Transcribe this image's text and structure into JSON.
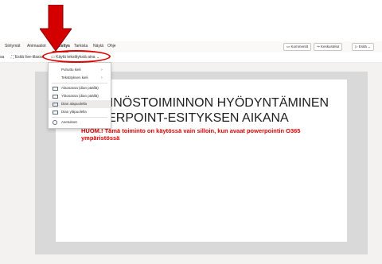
{
  "ribbon": {
    "tabs": [
      "Siirtymät",
      "Animaatiot",
      "Diaesitys",
      "Tarkista",
      "Näytä",
      "Ohje"
    ],
    "active_tab": "Diaesitys",
    "right_buttons": [
      "Kommentit",
      "Keskustelut",
      "Esitä"
    ]
  },
  "commands": {
    "left_cut": "sa",
    "present_live": "Esitä live-tilassa",
    "subtitles_button": "Käytä tekstityksiä aina"
  },
  "menu": {
    "items": [
      {
        "label": "Puhuttu kieli",
        "icon": "none",
        "submenu": true
      },
      {
        "label": "Tekstityksen kieli",
        "icon": "none",
        "submenu": true
      },
      {
        "label": "Alaosassa (dian päällä)",
        "icon": "bottom-overlay-icon",
        "submenu": false
      },
      {
        "label": "Yläosassa (dian päällä)",
        "icon": "top-overlay-icon",
        "submenu": false
      },
      {
        "label": "Dian alapuolella",
        "icon": "below-slide-icon",
        "submenu": false,
        "selected": true
      },
      {
        "label": "Dian yläpuolella",
        "icon": "above-slide-icon",
        "submenu": false
      },
      {
        "label": "Asetukset",
        "icon": "gear-icon",
        "submenu": false
      }
    ]
  },
  "slide": {
    "title_line1": "ÄNNÖSTOIMINNON HYÖDYNTÄMINEN",
    "title_line2": "WERPOINT-ESITYKSEN AIKANA",
    "note": "HUOM.! Tämä toiminto on käytössä vain silloin, kun avaat powerpointin O365 ympäristössä"
  },
  "colors": {
    "annotation_red": "#e00000",
    "accent": "#b7472a"
  }
}
